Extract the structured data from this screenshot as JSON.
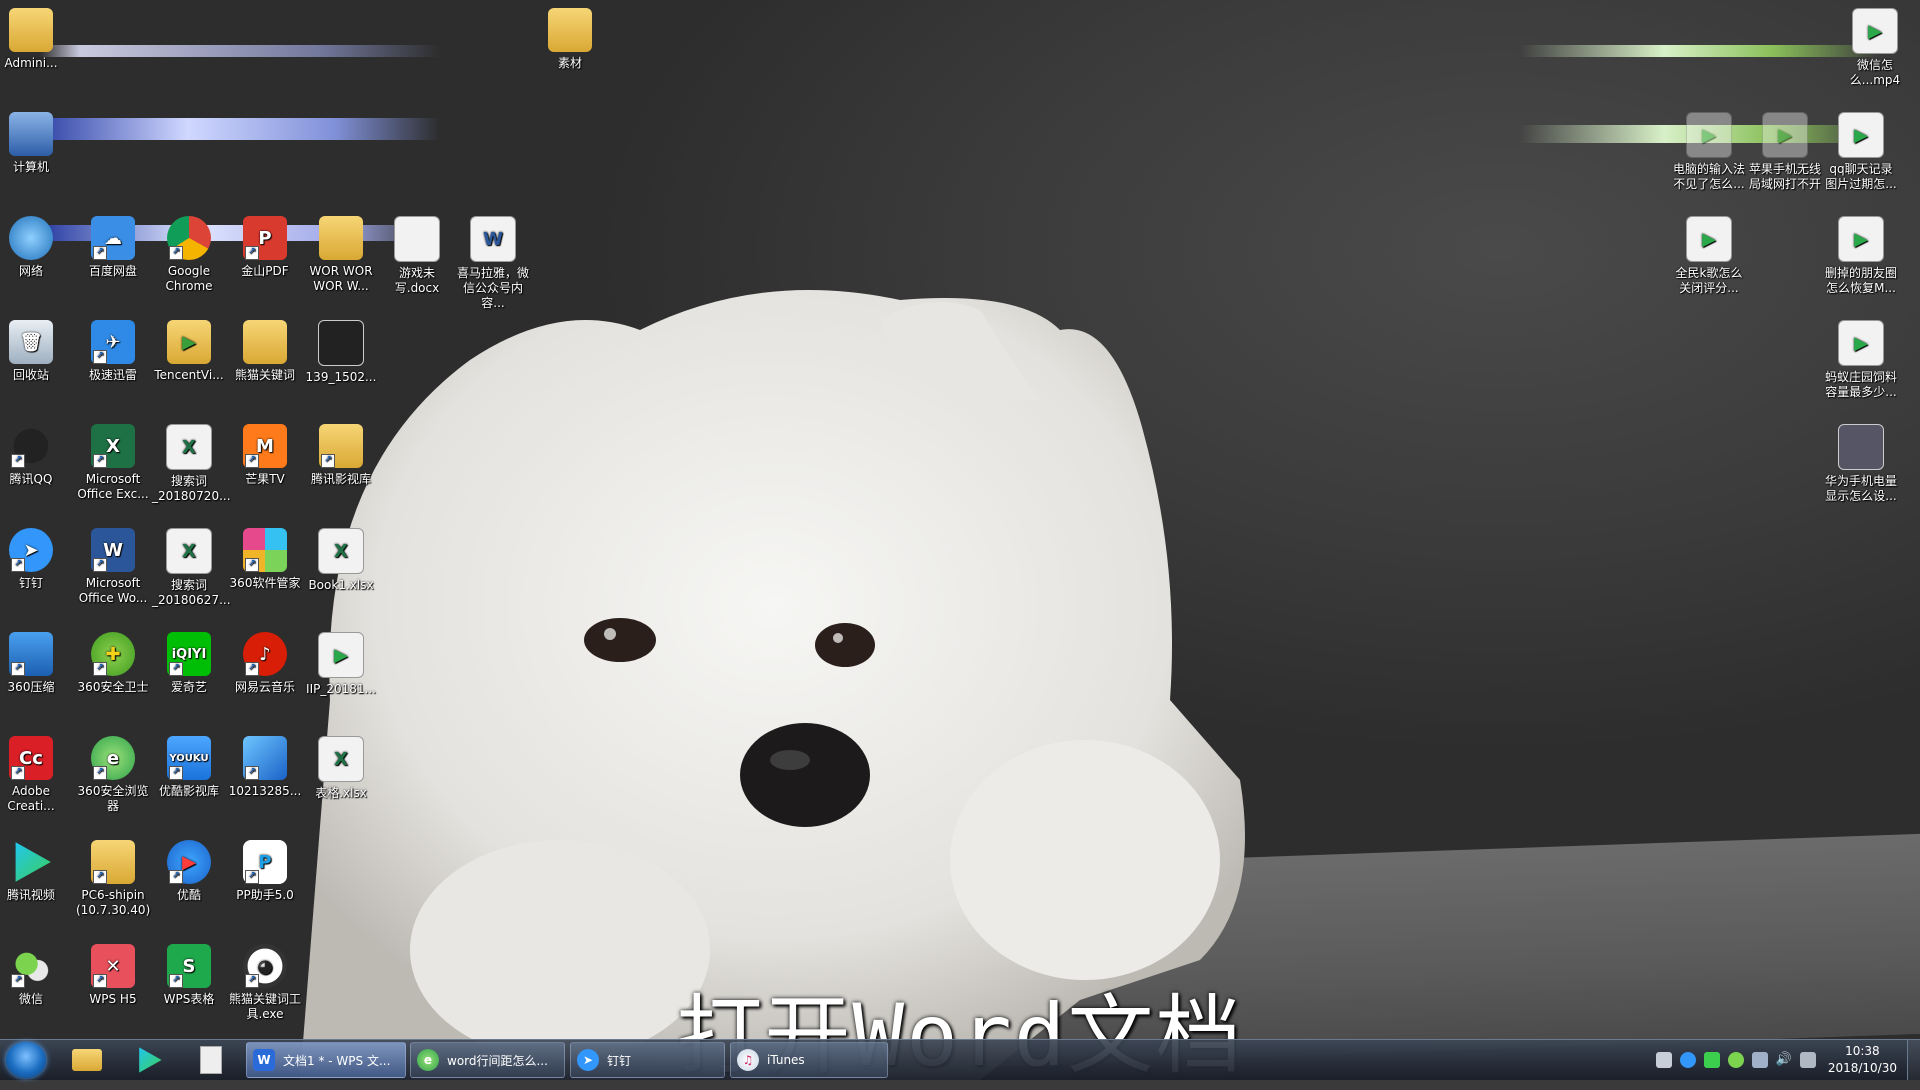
{
  "desktop": {
    "subtitle": "打开Word文档",
    "icons": {
      "admin": "Admini...",
      "sucai": "素材",
      "computer": "计算机",
      "network": "网络",
      "baidu": "百度网盘",
      "chrome": "Google Chrome",
      "jinshan": "金山PDF",
      "worworwor": "WOR WOR WOR W...",
      "game_doc": "游戏未写.docx",
      "himalaya": "喜马拉雅，微信公众号内容...",
      "recycle": "回收站",
      "xunlei": "极速迅雷",
      "tencentvi": "TencentVi...",
      "keyword_folder": "熊猫关键词",
      "img139": "139_1502...",
      "qq": "腾讯QQ",
      "excel": "Microsoft Office Exc...",
      "search1": "搜索词_20180720...",
      "mango": "芒果TV",
      "txvideo_lib": "腾讯影视库",
      "dingtalk": "钉钉",
      "word": "Microsoft Office Wo...",
      "search2": "搜索词_20180627...",
      "soft360": "360软件管家",
      "book1": "Book1.xlsx",
      "zip360": "360压缩",
      "safe360": "360安全卫士",
      "iqiyi": "爱奇艺",
      "netease": "网易云音乐",
      "flv": "IIP_20181...",
      "adobe": "Adobe Creati...",
      "browser360": "360安全浏览器",
      "youku_lib": "优酷影视库",
      "pkg": "10213285...",
      "xlsx": "表格.xlsx",
      "txvideo": "腾讯视频",
      "pc6": "PC6-shipin (10.7.30.40)",
      "youku": "优酷",
      "pp": "PP助手5.0",
      "wechat": "微信",
      "wpsh5": "WPS H5",
      "wpsbiao": "WPS表格",
      "panda": "熊猫关键词工具.exe",
      "r_wechat_mp4": "微信怎么...mp4",
      "r_input": "电脑的输入法不见了怎么...",
      "r_apple": "苹果手机无线局域网打不开",
      "r_qq": "qq聊天记录图片过期怎...",
      "r_kge": "全民k歌怎么关闭评分...",
      "r_friends": "删掉的朋友圈怎么恢复M...",
      "r_ant": "蚂蚁庄园饲料容量最多少...",
      "r_huawei": "华为手机电量显示怎么设..."
    }
  },
  "taskbar": {
    "tasks": [
      {
        "label": "文档1 * - WPS 文..."
      },
      {
        "label": "word行间距怎么..."
      },
      {
        "label": "钉钉"
      },
      {
        "label": "iTunes"
      }
    ],
    "clock": {
      "time": "10:38",
      "date": "2018/10/30"
    }
  }
}
